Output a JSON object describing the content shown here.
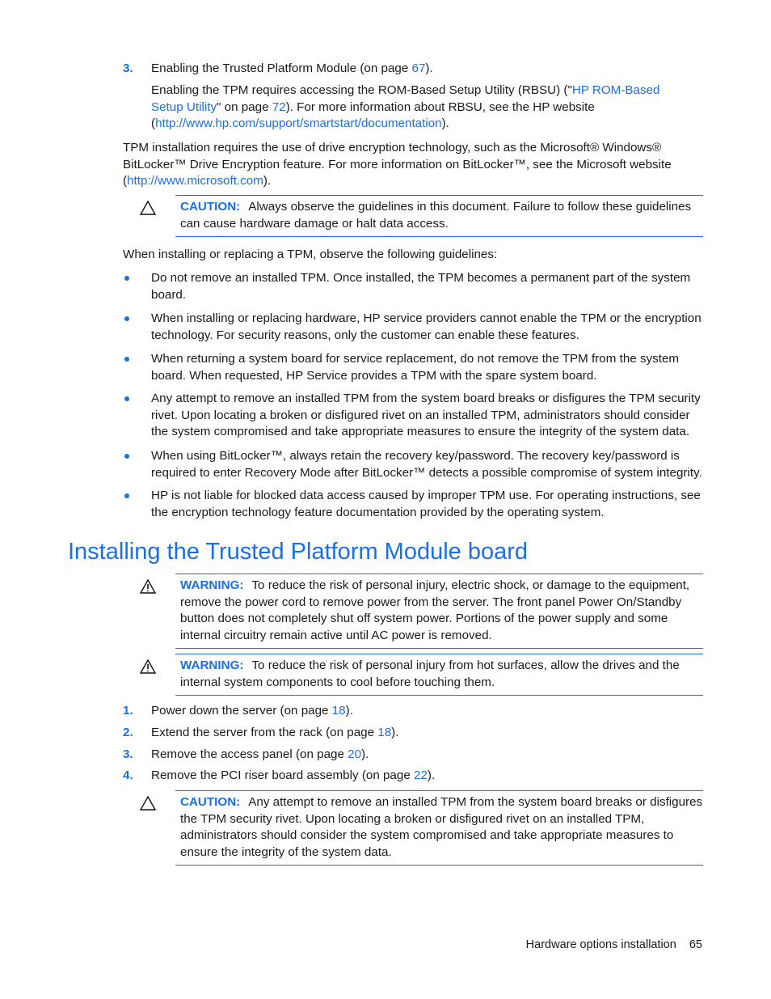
{
  "step3_top": {
    "number": "3.",
    "text_before": "Enabling the Trusted Platform Module (on page ",
    "link": "67",
    "text_after": ").",
    "detail": {
      "t1": "Enabling the TPM requires accessing the ROM-Based Setup Utility (RBSU) (\"",
      "link1": "HP ROM-Based Setup Utility",
      "t2": "\" on page ",
      "link2": "72",
      "t3": "). For more information about RBSU, see the HP website (",
      "link3": "http://www.hp.com/support/smartstart/documentation",
      "t4": ")."
    }
  },
  "intro": {
    "t1": "TPM installation requires the use of drive encryption technology, such as the Microsoft® Windows® BitLocker™ Drive Encryption feature. For more information on BitLocker™, see the Microsoft website (",
    "link": "http://www.microsoft.com",
    "t2": ")."
  },
  "caution1": {
    "icon": "caution-triangle-icon",
    "label": "CAUTION:",
    "text": "Always observe the guidelines in this document. Failure to follow these guidelines can cause hardware damage or halt data access."
  },
  "guidelines_intro": "When installing or replacing a TPM, observe the following guidelines:",
  "guidelines": [
    "Do not remove an installed TPM. Once installed, the TPM becomes a permanent part of the system board.",
    "When installing or replacing hardware, HP service providers cannot enable the TPM or the encryption technology. For security reasons, only the customer can enable these features.",
    "When returning a system board for service replacement, do not remove the TPM from the system board. When requested, HP Service provides a TPM with the spare system board.",
    "Any attempt to remove an installed TPM from the system board breaks or disfigures the TPM security rivet. Upon locating a broken or disfigured rivet on an installed TPM, administrators should consider the system compromised and take appropriate measures to ensure the integrity of the system data.",
    "When using BitLocker™, always retain the recovery key/password. The recovery key/password is required to enter Recovery Mode after BitLocker™ detects a possible compromise of system integrity.",
    "HP is not liable for blocked data access caused by improper TPM use. For operating instructions, see the encryption technology feature documentation provided by the operating system."
  ],
  "section_title": "Installing the Trusted Platform Module board",
  "warning1": {
    "icon": "warning-triangle-icon",
    "label": "WARNING:",
    "text": "To reduce the risk of personal injury, electric shock, or damage to the equipment, remove the power cord to remove power from the server. The front panel Power On/Standby button does not completely shut off system power. Portions of the power supply and some internal circuitry remain active until AC power is removed."
  },
  "warning2": {
    "icon": "warning-triangle-icon",
    "label": "WARNING:",
    "text": "To reduce the risk of personal injury from hot surfaces, allow the drives and the internal system components to cool before touching them."
  },
  "steps": [
    {
      "number": "1.",
      "text": "Power down the server (on page ",
      "link": "18",
      "after": ")."
    },
    {
      "number": "2.",
      "text": "Extend the server from the rack (on page ",
      "link": "18",
      "after": ")."
    },
    {
      "number": "3.",
      "text": "Remove the access panel (on page ",
      "link": "20",
      "after": ")."
    },
    {
      "number": "4.",
      "text": "Remove the PCI riser board assembly (on page ",
      "link": "22",
      "after": ")."
    }
  ],
  "caution2": {
    "icon": "caution-triangle-icon",
    "label": "CAUTION:",
    "text": "Any attempt to remove an installed TPM from the system board breaks or disfigures the TPM security rivet. Upon locating a broken or disfigured rivet on an installed TPM, administrators should consider the system compromised and take appropriate measures to ensure the integrity of the system data."
  },
  "footer": {
    "section": "Hardware options installation",
    "page": "65"
  }
}
